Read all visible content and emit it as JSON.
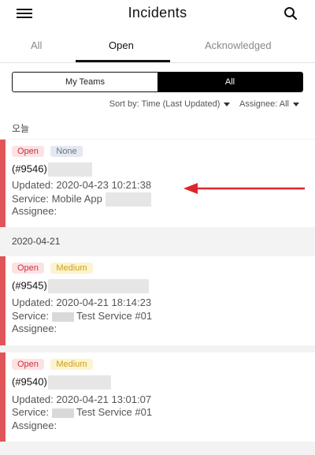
{
  "header": {
    "title": "Incidents",
    "menu_icon": "menu-icon",
    "search_icon": "search-icon"
  },
  "tabs": [
    {
      "label": "All"
    },
    {
      "label": "Open"
    },
    {
      "label": "Acknowledged"
    }
  ],
  "filters": {
    "segments": [
      "My Teams",
      "All"
    ],
    "sort_label": "Sort by: Time (Last Updated)",
    "assignee_label": "Assignee: All"
  },
  "groups": {
    "today": "오늘",
    "date2": "2020-04-21"
  },
  "incidents": [
    {
      "status": "Open",
      "priority": "None",
      "id": "(#9546)",
      "updated": "Updated: 2020-04-23 10:21:38",
      "service": "Service: Mobile App",
      "assignee": "Assignee:"
    },
    {
      "status": "Open",
      "priority": "Medium",
      "id": "(#9545)",
      "updated": "Updated: 2020-04-21 18:14:23",
      "service": "Service:",
      "service_suffix": "Test Service #01",
      "assignee": "Assignee:"
    },
    {
      "status": "Open",
      "priority": "Medium",
      "id": "(#9540)",
      "updated": "Updated: 2020-04-21 13:01:07",
      "service": "Service:",
      "service_suffix": "Test Service #01",
      "assignee": "Assignee:"
    }
  ],
  "colors": {
    "accent": "#e15558",
    "arrow": "#e0242b"
  }
}
